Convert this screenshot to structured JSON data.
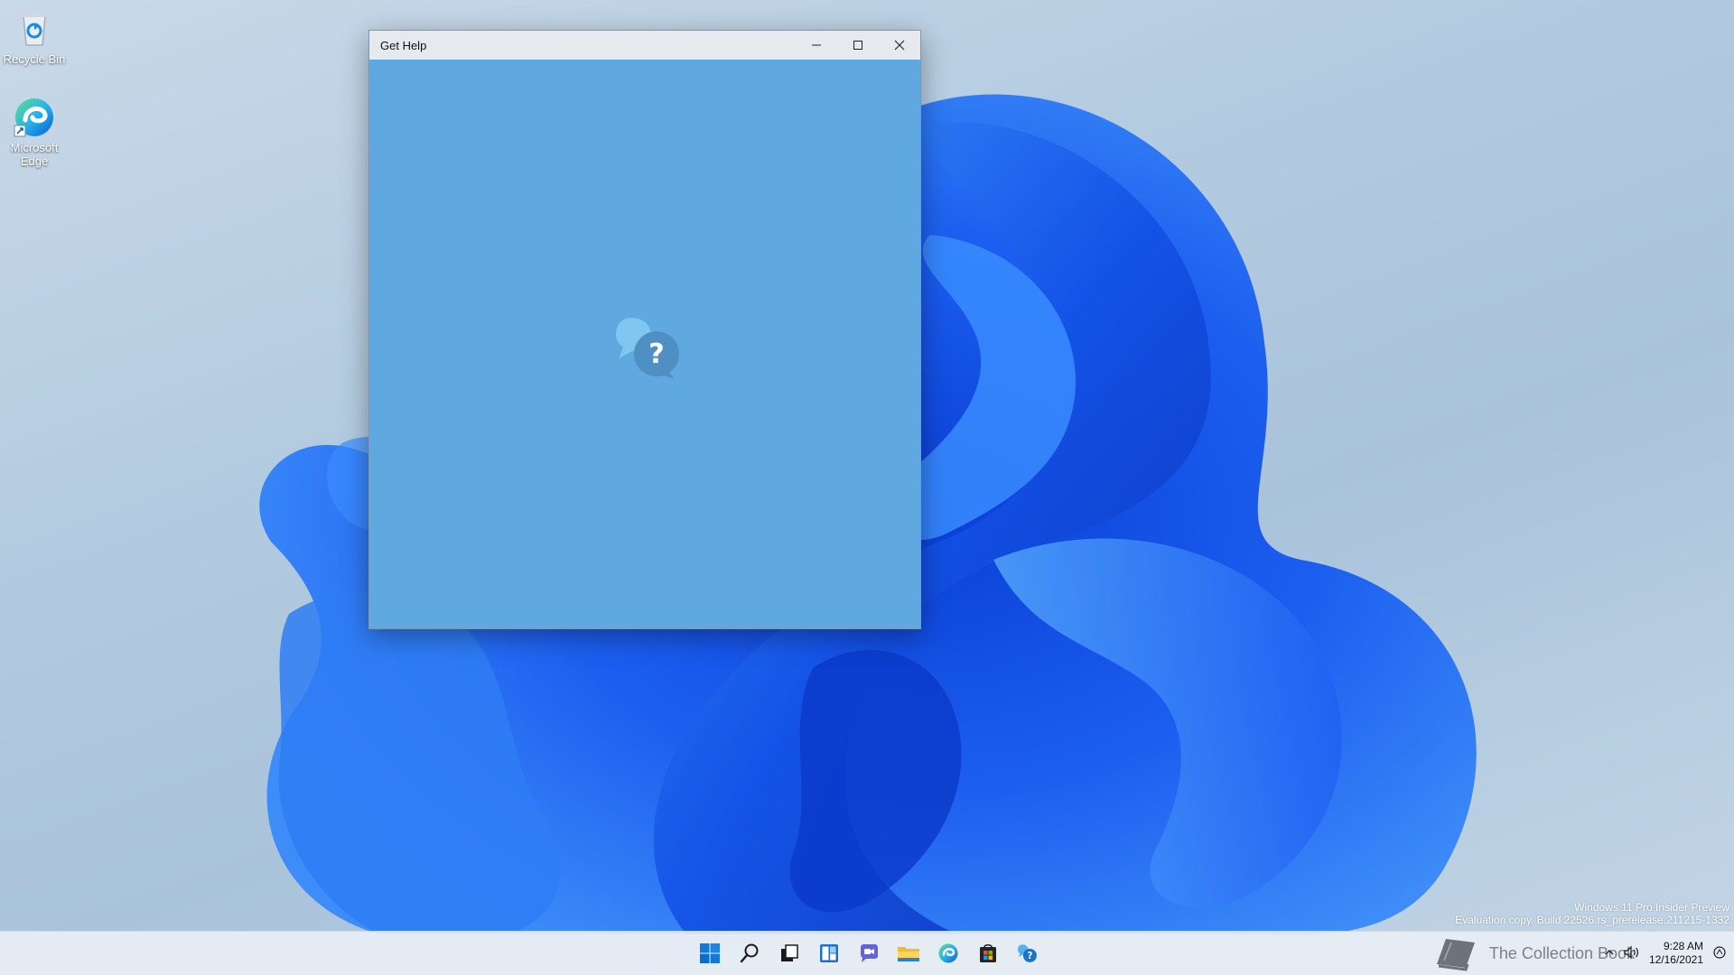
{
  "desktop": {
    "icons": [
      {
        "label": "Recycle Bin",
        "icon": "recycle-bin-icon"
      },
      {
        "label": "Microsoft Edge",
        "icon": "edge-icon"
      }
    ],
    "watermark": {
      "line1": "Windows 11 Pro Insider Preview",
      "line2": "Evaluation copy. Build 22526.rs_prerelease.211215-1332"
    }
  },
  "window": {
    "title": "Get Help",
    "background": "#5fa8e0",
    "splash_icon": "get-help-icon",
    "controls": [
      "minimize",
      "maximize",
      "close"
    ]
  },
  "taskbar": {
    "apps": [
      {
        "name": "Start",
        "icon": "windows-logo-icon"
      },
      {
        "name": "Search",
        "icon": "search-icon"
      },
      {
        "name": "Task View",
        "icon": "task-view-icon"
      },
      {
        "name": "Widgets",
        "icon": "widgets-icon"
      },
      {
        "name": "Chat",
        "icon": "chat-icon"
      },
      {
        "name": "File Explorer",
        "icon": "folder-icon"
      },
      {
        "name": "Microsoft Edge",
        "icon": "edge-icon"
      },
      {
        "name": "Microsoft Store",
        "icon": "store-icon"
      },
      {
        "name": "Get Help",
        "icon": "get-help-icon"
      }
    ],
    "brand": "The Collection Book",
    "clock": {
      "time": "9:28 AM",
      "date": "12/16/2021"
    }
  }
}
